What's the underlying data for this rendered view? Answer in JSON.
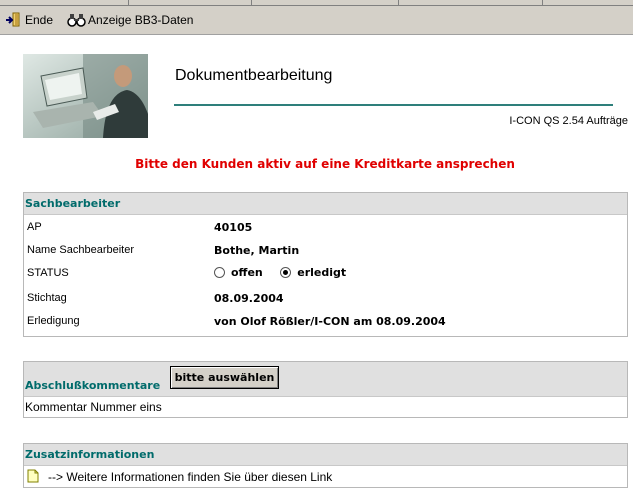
{
  "toolbar": {
    "exit_label": "Ende",
    "show_label": "Anzeige BB3-Daten"
  },
  "header": {
    "title": "Dokumentbearbeitung",
    "version": "I-CON QS 2.54 Aufträge"
  },
  "warning": "Bitte den Kunden aktiv auf eine Kreditkarte ansprechen",
  "sachbearbeiter": {
    "heading": "Sachbearbeiter",
    "rows": [
      {
        "key": "AP",
        "value": "40105"
      },
      {
        "key": "Name Sachbearbeiter",
        "value": "Bothe, Martin"
      },
      {
        "key": "STATUS",
        "value": ""
      },
      {
        "key": "Stichtag",
        "value": "08.09.2004"
      },
      {
        "key": "Erledigung",
        "value": "von Olof Rößler/I-CON  am 08.09.2004"
      }
    ],
    "status_options": [
      {
        "label": "offen",
        "selected": false
      },
      {
        "label": "erledigt",
        "selected": true
      }
    ]
  },
  "abschluss": {
    "heading": "Abschlußkommentare",
    "button": "bitte auswählen",
    "comment": "Kommentar Nummer eins"
  },
  "zusatz": {
    "heading": "Zusatzinformationen",
    "link_text": "--> Weitere Informationen finden Sie über diesen Link"
  },
  "colors": {
    "accent": "#2e7f7b",
    "heading_text": "#006b6b",
    "warning": "#e00000",
    "toolbar_bg": "#d4d0c8",
    "panel_head_bg": "#e0e0e0"
  },
  "icons": {
    "exit": "exit-door-icon",
    "show": "binoculars-icon",
    "link": "document-icon"
  }
}
